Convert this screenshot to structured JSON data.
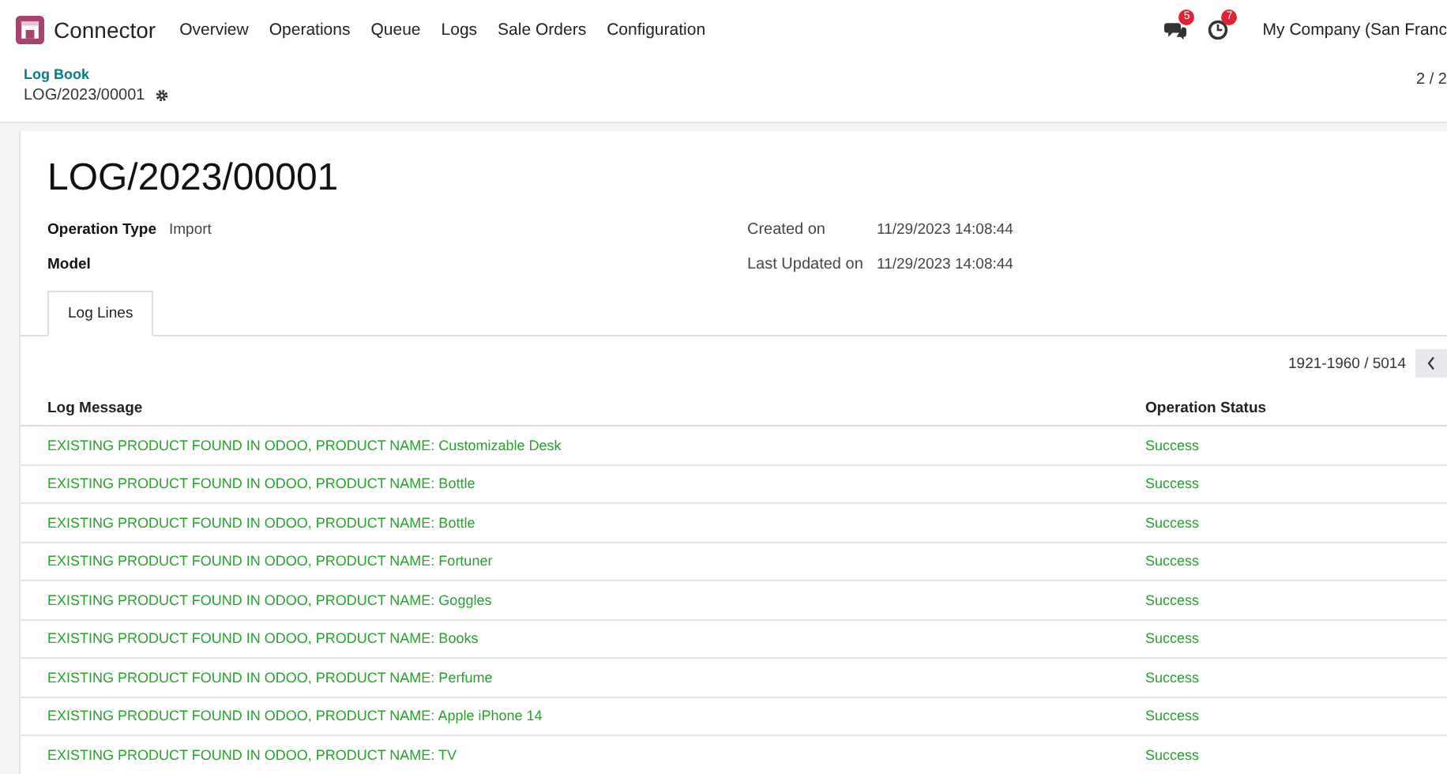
{
  "navbar": {
    "app_name": "Connector",
    "menu": [
      "Overview",
      "Operations",
      "Queue",
      "Logs",
      "Sale Orders",
      "Configuration"
    ],
    "messages_count": "5",
    "activities_count": "7",
    "company": "My Company (San Franc"
  },
  "breadcrumb": {
    "parent": "Log Book",
    "current": "LOG/2023/00001"
  },
  "pager": "2 / 2",
  "record": {
    "title": "LOG/2023/00001",
    "fields_left": [
      {
        "label": "Operation Type",
        "value": "Import"
      },
      {
        "label": "Model"
      }
    ],
    "fields_right": [
      {
        "label": "Created on",
        "value": "11/29/2023 14:08:44"
      },
      {
        "label": "Last Updated on",
        "value": "11/29/2023 14:08:44"
      }
    ]
  },
  "tabs": [
    {
      "label": "Log Lines",
      "selected": true
    }
  ],
  "table": {
    "pager": "1921-1960 / 5014",
    "columns": [
      "Log Message",
      "Operation Status"
    ],
    "rows": [
      {
        "message": "EXISTING PRODUCT FOUND IN ODOO, PRODUCT NAME: Customizable Desk",
        "status": "Success"
      },
      {
        "message": "EXISTING PRODUCT FOUND IN ODOO, PRODUCT NAME: Bottle",
        "status": "Success"
      },
      {
        "message": "EXISTING PRODUCT FOUND IN ODOO, PRODUCT NAME: Bottle",
        "status": "Success"
      },
      {
        "message": "EXISTING PRODUCT FOUND IN ODOO, PRODUCT NAME: Fortuner",
        "status": "Success"
      },
      {
        "message": "EXISTING PRODUCT FOUND IN ODOO, PRODUCT NAME: Goggles",
        "status": "Success"
      },
      {
        "message": "EXISTING PRODUCT FOUND IN ODOO, PRODUCT NAME: Books",
        "status": "Success"
      },
      {
        "message": "EXISTING PRODUCT FOUND IN ODOO, PRODUCT NAME: Perfume",
        "status": "Success"
      },
      {
        "message": "EXISTING PRODUCT FOUND IN ODOO, PRODUCT NAME: Apple iPhone 14",
        "status": "Success"
      },
      {
        "message": "EXISTING PRODUCT FOUND IN ODOO, PRODUCT NAME: TV",
        "status": "Success"
      }
    ]
  }
}
